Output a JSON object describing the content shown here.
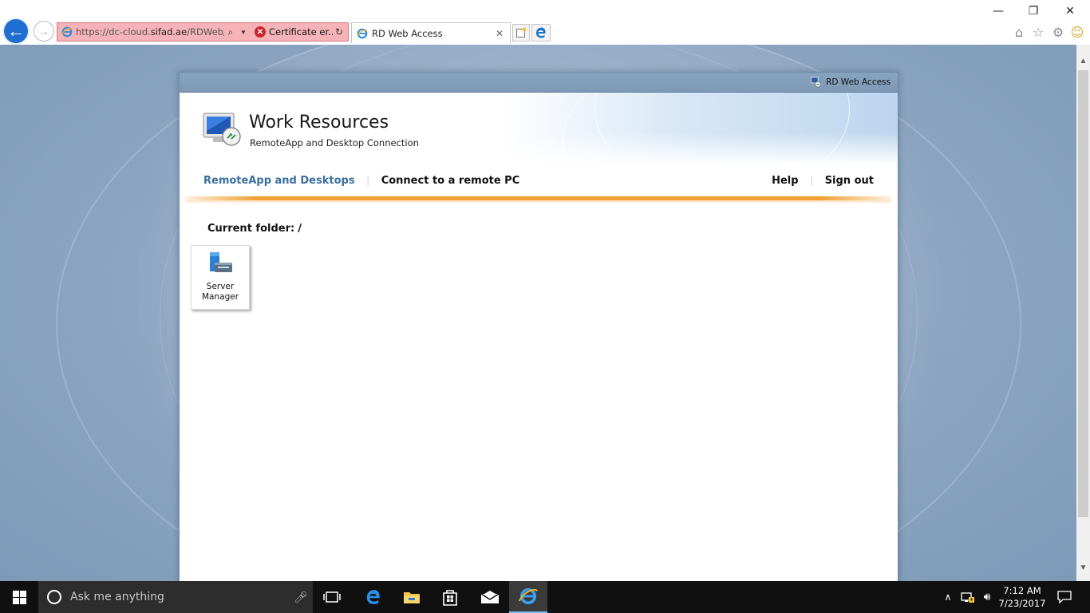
{
  "browser": {
    "address_url_prefix": "https://dc-cloud.",
    "address_url_domain": "sifad.ae",
    "address_url_path": "/RDWeb/F",
    "certificate_label": "Certificate er...",
    "tab_title": "RD Web Access",
    "icons": [
      "back-arrow-icon",
      "forward-arrow-icon",
      "ie-icon",
      "search-icon",
      "dropdown-icon",
      "certificate-error-icon",
      "refresh-icon",
      "close-icon",
      "new-tab-icon",
      "edge-icon",
      "home-icon",
      "favorites-star-icon",
      "settings-gear-icon",
      "smiley-feedback-icon"
    ],
    "window_controls": {
      "minimize": "—",
      "restore": "❐",
      "close": "✕"
    }
  },
  "rdweb": {
    "header_label": "RD Web Access",
    "title": "Work Resources",
    "subtitle": "RemoteApp and Desktop Connection",
    "nav": {
      "remoteapp": "RemoteApp and Desktops",
      "connect": "Connect to a remote PC",
      "help": "Help",
      "signout": "Sign out"
    },
    "current_folder_label": "Current folder:",
    "current_folder_path": "/",
    "apps": [
      {
        "label": "Server Manager",
        "icon": "server-manager-icon"
      }
    ],
    "colors": {
      "nav_active": "#3a6f9c",
      "accent_rule": "#f0a030"
    }
  },
  "taskbar": {
    "search_placeholder": "Ask me anything",
    "time": "7:12 AM",
    "date": "7/23/2017",
    "icons": [
      "windows-start-icon",
      "cortana-icon",
      "microphone-icon",
      "task-view-icon",
      "edge-icon",
      "file-explorer-icon",
      "store-icon",
      "mail-icon",
      "internet-explorer-icon",
      "show-hidden-icons-chevron",
      "network-icon",
      "volume-icon",
      "action-center-icon"
    ]
  }
}
